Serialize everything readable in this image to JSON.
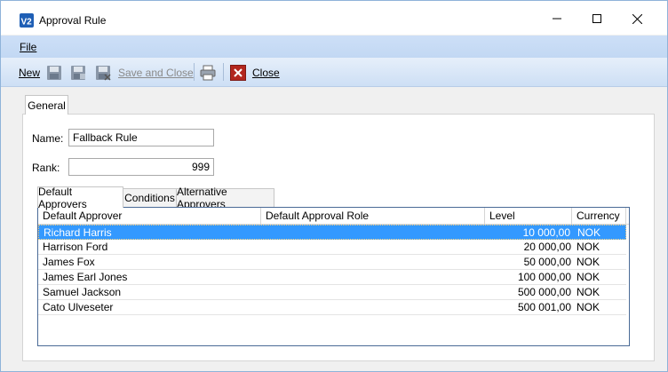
{
  "window": {
    "title": "Approval Rule",
    "controls": {
      "minimize": "minimize",
      "maximize": "maximize",
      "close": "close"
    }
  },
  "menu": {
    "file_label": "File"
  },
  "toolbar": {
    "new_label": "New",
    "save_and_close_label": "Save and Close",
    "close_label": "Close",
    "icons": [
      "save-icon",
      "save-new-icon",
      "save-delete-icon",
      "print-icon",
      "close-red-icon"
    ]
  },
  "tabs": {
    "general": "General"
  },
  "form": {
    "name_label": "Name:",
    "name_value": "Fallback Rule",
    "rank_label": "Rank:",
    "rank_value": "999"
  },
  "inner_tabs": [
    "Default Approvers",
    "Conditions",
    "Alternative Approvers"
  ],
  "grid": {
    "columns": [
      "Default Approver",
      "Default Approval Role",
      "Level",
      "Currency"
    ],
    "rows": [
      {
        "name": "Richard Harris",
        "role": "",
        "level": "10 000,00",
        "currency": "NOK",
        "selected": true
      },
      {
        "name": "Harrison Ford",
        "role": "",
        "level": "20 000,00",
        "currency": "NOK"
      },
      {
        "name": "James Fox",
        "role": "",
        "level": "50 000,00",
        "currency": "NOK"
      },
      {
        "name": "James Earl Jones",
        "role": "",
        "level": "100 000,00",
        "currency": "NOK"
      },
      {
        "name": "Samuel Jackson",
        "role": "",
        "level": "500 000,00",
        "currency": "NOK"
      },
      {
        "name": "Cato Ulveseter",
        "role": "",
        "level": "500 001,00",
        "currency": "NOK"
      }
    ]
  },
  "colors": {
    "selection": "#3399ff",
    "menubar": "#c8dcf5",
    "close_icon": "#c0392b"
  }
}
